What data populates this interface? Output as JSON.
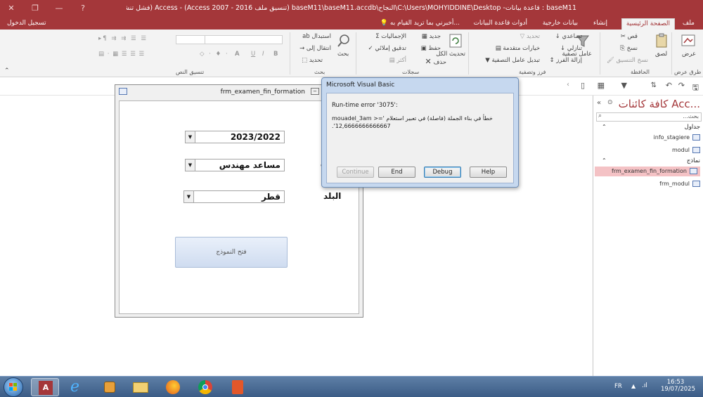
{
  "window": {
    "title": "baseM11 : قاعدة بيانات- C:\\Users\\MOHYIDDINE\\Desktop\\النجاح\\baseM11\\baseM11.accdb (تنسيق ملف Access 2007 - 2016) - Access (فشل تنشيط المنتج)",
    "sign_in": "تسجيل الدخول",
    "help_icon": "?"
  },
  "tabs": [
    "ملف",
    "الصفحة الرئيسية",
    "إنشاء",
    "بيانات خارجية",
    "أدوات قاعدة البيانات"
  ],
  "tell_me": "أخبرني بما تريد القيام به...",
  "ribbon": {
    "groups": {
      "views": "طرق عرض",
      "clipboard": "الحافظة",
      "sort_filter": "فرز وتصفية",
      "records": "سجلات",
      "find": "بحث",
      "text_format": "تنسيق النص"
    },
    "views": {
      "view": "عرض"
    },
    "clipboard": {
      "paste": "لصق",
      "cut": "قص",
      "copy": "نسخ",
      "format_painter": "نسخ التنسيق"
    },
    "sort_filter": {
      "filter": "عامل تصفية",
      "ascending": "تصاعدي",
      "descending": "تنازلي",
      "remove_sort": "إزالة الفرز",
      "selection": "تحديد",
      "advanced": "خيارات متقدمة",
      "toggle_filter": "تبديل عامل التصفية"
    },
    "records": {
      "refresh_all": "تحديث الكل",
      "new": "جديد",
      "save": "حفظ",
      "delete": "حذف",
      "totals": "الإجماليات",
      "spelling": "تدقيق إملائي",
      "more": "أكثر"
    },
    "find": {
      "find": "بحث",
      "replace": "استبدال",
      "goto": "انتقال إلى",
      "select": "تحديد"
    },
    "text_format": {
      "bold": "B",
      "italic": "I",
      "underline": "U",
      "font_color": "A"
    }
  },
  "nav": {
    "title": "كافة كائنات Acc...",
    "search_placeholder": "بحث...",
    "tables_label": "جداول",
    "forms_label": "نماذج",
    "tables": [
      "info_stagiere",
      "modul"
    ],
    "forms": [
      "frm_examen_fin_formation",
      "frm_modul"
    ]
  },
  "form": {
    "title": "frm_examen_fin_formation",
    "year_value": "2023/2022",
    "spec_value": "مساعد مهندس",
    "spec_label": "ة",
    "country_label": "البلد",
    "country_value": "قطر",
    "open_button": "فتح النموذج"
  },
  "dialog": {
    "title": "Microsoft Visual Basic",
    "error_code": "Run-time error '3075':",
    "error_message": "خطأ في بناء الجملة (فاصلة) في تعبير استعلام 'mouadel_3am >= 12,6666666666667'.",
    "buttons": {
      "continue": "Continue",
      "end": "End",
      "debug": "Debug",
      "help": "Help"
    }
  },
  "taskbar": {
    "lang": "FR",
    "time": "16:53",
    "date": "19/07/2025"
  },
  "colors": {
    "access_red": "#a4373a",
    "selected_item": "#f4c2c5",
    "dialog_frame": "#c6d8ef",
    "taskbar": "#3b5c86"
  }
}
